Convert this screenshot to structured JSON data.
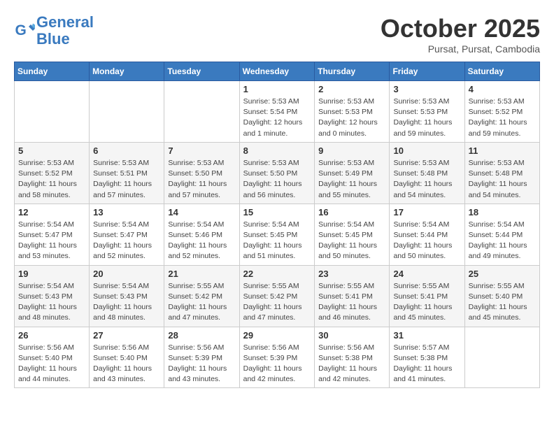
{
  "header": {
    "logo_line1": "General",
    "logo_line2": "Blue",
    "month": "October 2025",
    "location": "Pursat, Pursat, Cambodia"
  },
  "weekdays": [
    "Sunday",
    "Monday",
    "Tuesday",
    "Wednesday",
    "Thursday",
    "Friday",
    "Saturday"
  ],
  "weeks": [
    [
      {
        "day": "",
        "info": ""
      },
      {
        "day": "",
        "info": ""
      },
      {
        "day": "",
        "info": ""
      },
      {
        "day": "1",
        "info": "Sunrise: 5:53 AM\nSunset: 5:54 PM\nDaylight: 12 hours\nand 1 minute."
      },
      {
        "day": "2",
        "info": "Sunrise: 5:53 AM\nSunset: 5:53 PM\nDaylight: 12 hours\nand 0 minutes."
      },
      {
        "day": "3",
        "info": "Sunrise: 5:53 AM\nSunset: 5:53 PM\nDaylight: 11 hours\nand 59 minutes."
      },
      {
        "day": "4",
        "info": "Sunrise: 5:53 AM\nSunset: 5:52 PM\nDaylight: 11 hours\nand 59 minutes."
      }
    ],
    [
      {
        "day": "5",
        "info": "Sunrise: 5:53 AM\nSunset: 5:52 PM\nDaylight: 11 hours\nand 58 minutes."
      },
      {
        "day": "6",
        "info": "Sunrise: 5:53 AM\nSunset: 5:51 PM\nDaylight: 11 hours\nand 57 minutes."
      },
      {
        "day": "7",
        "info": "Sunrise: 5:53 AM\nSunset: 5:50 PM\nDaylight: 11 hours\nand 57 minutes."
      },
      {
        "day": "8",
        "info": "Sunrise: 5:53 AM\nSunset: 5:50 PM\nDaylight: 11 hours\nand 56 minutes."
      },
      {
        "day": "9",
        "info": "Sunrise: 5:53 AM\nSunset: 5:49 PM\nDaylight: 11 hours\nand 55 minutes."
      },
      {
        "day": "10",
        "info": "Sunrise: 5:53 AM\nSunset: 5:48 PM\nDaylight: 11 hours\nand 54 minutes."
      },
      {
        "day": "11",
        "info": "Sunrise: 5:53 AM\nSunset: 5:48 PM\nDaylight: 11 hours\nand 54 minutes."
      }
    ],
    [
      {
        "day": "12",
        "info": "Sunrise: 5:54 AM\nSunset: 5:47 PM\nDaylight: 11 hours\nand 53 minutes."
      },
      {
        "day": "13",
        "info": "Sunrise: 5:54 AM\nSunset: 5:47 PM\nDaylight: 11 hours\nand 52 minutes."
      },
      {
        "day": "14",
        "info": "Sunrise: 5:54 AM\nSunset: 5:46 PM\nDaylight: 11 hours\nand 52 minutes."
      },
      {
        "day": "15",
        "info": "Sunrise: 5:54 AM\nSunset: 5:45 PM\nDaylight: 11 hours\nand 51 minutes."
      },
      {
        "day": "16",
        "info": "Sunrise: 5:54 AM\nSunset: 5:45 PM\nDaylight: 11 hours\nand 50 minutes."
      },
      {
        "day": "17",
        "info": "Sunrise: 5:54 AM\nSunset: 5:44 PM\nDaylight: 11 hours\nand 50 minutes."
      },
      {
        "day": "18",
        "info": "Sunrise: 5:54 AM\nSunset: 5:44 PM\nDaylight: 11 hours\nand 49 minutes."
      }
    ],
    [
      {
        "day": "19",
        "info": "Sunrise: 5:54 AM\nSunset: 5:43 PM\nDaylight: 11 hours\nand 48 minutes."
      },
      {
        "day": "20",
        "info": "Sunrise: 5:54 AM\nSunset: 5:43 PM\nDaylight: 11 hours\nand 48 minutes."
      },
      {
        "day": "21",
        "info": "Sunrise: 5:55 AM\nSunset: 5:42 PM\nDaylight: 11 hours\nand 47 minutes."
      },
      {
        "day": "22",
        "info": "Sunrise: 5:55 AM\nSunset: 5:42 PM\nDaylight: 11 hours\nand 47 minutes."
      },
      {
        "day": "23",
        "info": "Sunrise: 5:55 AM\nSunset: 5:41 PM\nDaylight: 11 hours\nand 46 minutes."
      },
      {
        "day": "24",
        "info": "Sunrise: 5:55 AM\nSunset: 5:41 PM\nDaylight: 11 hours\nand 45 minutes."
      },
      {
        "day": "25",
        "info": "Sunrise: 5:55 AM\nSunset: 5:40 PM\nDaylight: 11 hours\nand 45 minutes."
      }
    ],
    [
      {
        "day": "26",
        "info": "Sunrise: 5:56 AM\nSunset: 5:40 PM\nDaylight: 11 hours\nand 44 minutes."
      },
      {
        "day": "27",
        "info": "Sunrise: 5:56 AM\nSunset: 5:40 PM\nDaylight: 11 hours\nand 43 minutes."
      },
      {
        "day": "28",
        "info": "Sunrise: 5:56 AM\nSunset: 5:39 PM\nDaylight: 11 hours\nand 43 minutes."
      },
      {
        "day": "29",
        "info": "Sunrise: 5:56 AM\nSunset: 5:39 PM\nDaylight: 11 hours\nand 42 minutes."
      },
      {
        "day": "30",
        "info": "Sunrise: 5:56 AM\nSunset: 5:38 PM\nDaylight: 11 hours\nand 42 minutes."
      },
      {
        "day": "31",
        "info": "Sunrise: 5:57 AM\nSunset: 5:38 PM\nDaylight: 11 hours\nand 41 minutes."
      },
      {
        "day": "",
        "info": ""
      }
    ]
  ]
}
